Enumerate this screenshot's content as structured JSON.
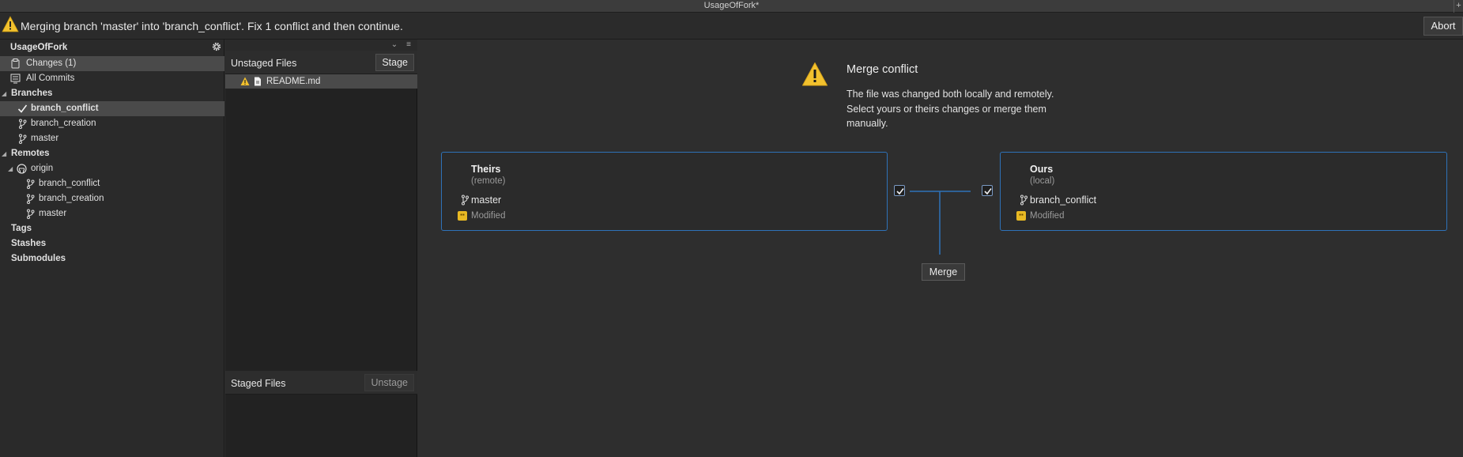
{
  "window": {
    "title": "UsageOfFork*"
  },
  "banner": {
    "message": "Merging branch 'master' into 'branch_conflict'. Fix 1 conflict and then continue.",
    "abort_label": "Abort"
  },
  "sidebar": {
    "repo_name": "UsageOfFork",
    "changes_label": "Changes (1)",
    "all_commits_label": "All Commits",
    "branches_label": "Branches",
    "branches": [
      "branch_conflict",
      "branch_creation",
      "master"
    ],
    "remotes_label": "Remotes",
    "remote_name": "origin",
    "remote_branches": [
      "branch_conflict",
      "branch_creation",
      "master"
    ],
    "tags_label": "Tags",
    "stashes_label": "Stashes",
    "submodules_label": "Submodules"
  },
  "files": {
    "unstaged_title": "Unstaged Files",
    "stage_label": "Stage",
    "unstaged_items": [
      "README.md"
    ],
    "staged_title": "Staged Files",
    "unstage_label": "Unstage"
  },
  "conflict": {
    "title": "Merge conflict",
    "description": "The file was changed both locally and remotely. Select yours or theirs changes or merge them manually.",
    "theirs": {
      "title": "Theirs",
      "sub": "(remote)",
      "branch": "master",
      "status": "Modified"
    },
    "ours": {
      "title": "Ours",
      "sub": "(local)",
      "branch": "branch_conflict",
      "status": "Modified"
    },
    "merge_label": "Merge"
  },
  "colors": {
    "accent": "#2e72b8",
    "warning": "#f2c12e",
    "modified_badge": "#e8b923"
  }
}
